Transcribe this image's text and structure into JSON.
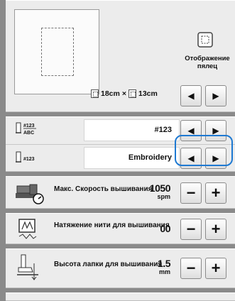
{
  "hoop_section": {
    "display_label": "Отображение пялец",
    "width_label": "18cm",
    "times_label": "×",
    "height_label": "13cm",
    "prev_icon": "left-triangle",
    "next_icon": "right-triangle"
  },
  "thread_number": {
    "icon": "thread-number-icon",
    "value": "#123"
  },
  "thread_color": {
    "icon": "thread-color-icon",
    "value": "Embroidery"
  },
  "max_speed": {
    "label": "Макс. Скорость вышивания",
    "value": "1050",
    "unit": "spm"
  },
  "thread_tension": {
    "label": "Натяжение нити для вышивания",
    "value": "00"
  },
  "foot_height": {
    "label": "Высота лапки для вышивания",
    "value": "1.5",
    "unit": "mm"
  },
  "symbols": {
    "minus": "−",
    "plus": "+",
    "left": "◀",
    "right": "▶"
  },
  "colors": {
    "focus": "#1e79d2",
    "panel": "#ececec",
    "frame": "#8a8a8a"
  }
}
